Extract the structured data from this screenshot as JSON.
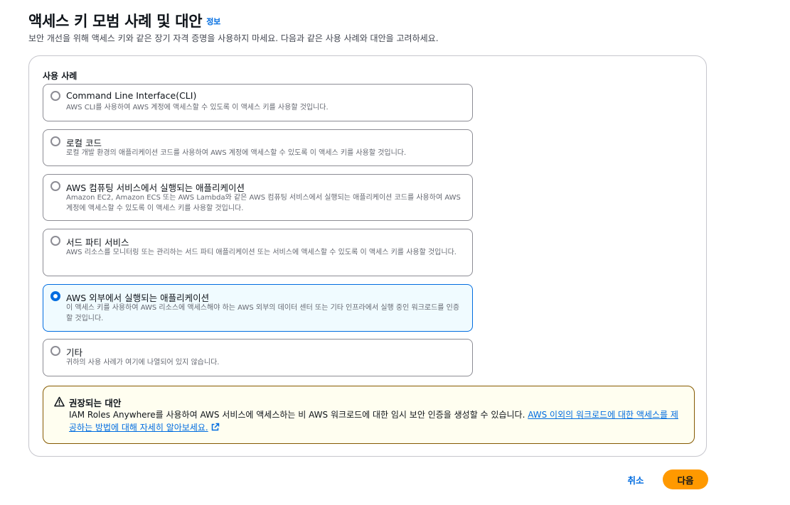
{
  "header": {
    "title": "액세스 키 모범 사례 및 대안",
    "info_link": "정보",
    "description": "보안 개선을 위해 액세스 키와 같은 장기 자격 증명을 사용하지 마세요. 다음과 같은 사용 사례와 대안을 고려하세요."
  },
  "use_cases": {
    "label": "사용 사례",
    "selected_index": 4,
    "options": [
      {
        "title": "Command Line Interface(CLI)",
        "description": "AWS CLI를 사용하여 AWS 계정에 액세스할 수 있도록 이 액세스 키를 사용할 것입니다."
      },
      {
        "title": "로컬 코드",
        "description": "로컬 개발 환경의 애플리케이션 코드를 사용하여 AWS 계정에 액세스할 수 있도록 이 액세스 키를 사용할 것입니다."
      },
      {
        "title": "AWS 컴퓨팅 서비스에서 실행되는 애플리케이션",
        "description": "Amazon EC2, Amazon ECS 또는 AWS Lambda와 같은 AWS 컴퓨팅 서비스에서 실행되는 애플리케이션 코드를 사용하여 AWS 계정에 액세스할 수 있도록 이 액세스 키를 사용할 것입니다."
      },
      {
        "title": "서드 파티 서비스",
        "description": "AWS 리소스를 모니터링 또는 관리하는 서드 파티 애플리케이션 또는 서비스에 액세스할 수 있도록 이 액세스 키를 사용할 것입니다."
      },
      {
        "title": "AWS 외부에서 실행되는 애플리케이션",
        "description": "이 액세스 키를 사용하여 AWS 리소스에 액세스해야 하는 AWS 외부의 데이터 센터 또는 기타 인프라에서 실행 중인 워크로드를 인증할 것입니다."
      },
      {
        "title": "기타",
        "description": "귀하의 사용 사례가 여기에 나열되어 있지 않습니다."
      }
    ]
  },
  "alert": {
    "title": "권장되는 대안",
    "body": "IAM Roles Anywhere를 사용하여 AWS 서비스에 액세스하는 비 AWS 워크로드에 대한 임시 보안 인증을 생성할 수 있습니다. ",
    "link": "AWS 이외의 워크로드에 대한 액세스를 제공하는 방법에 대해 자세히 알아보세요."
  },
  "footer": {
    "cancel_label": "취소",
    "next_label": "다음"
  },
  "colors": {
    "accent": "#006ce0",
    "selected_background": "#f0fbff",
    "warning_border": "#855900",
    "warning_background": "#fffef0",
    "primary_button": "#ff9900"
  },
  "icons": {
    "alert": "warning-triangle-icon",
    "link": "external-link-icon"
  }
}
